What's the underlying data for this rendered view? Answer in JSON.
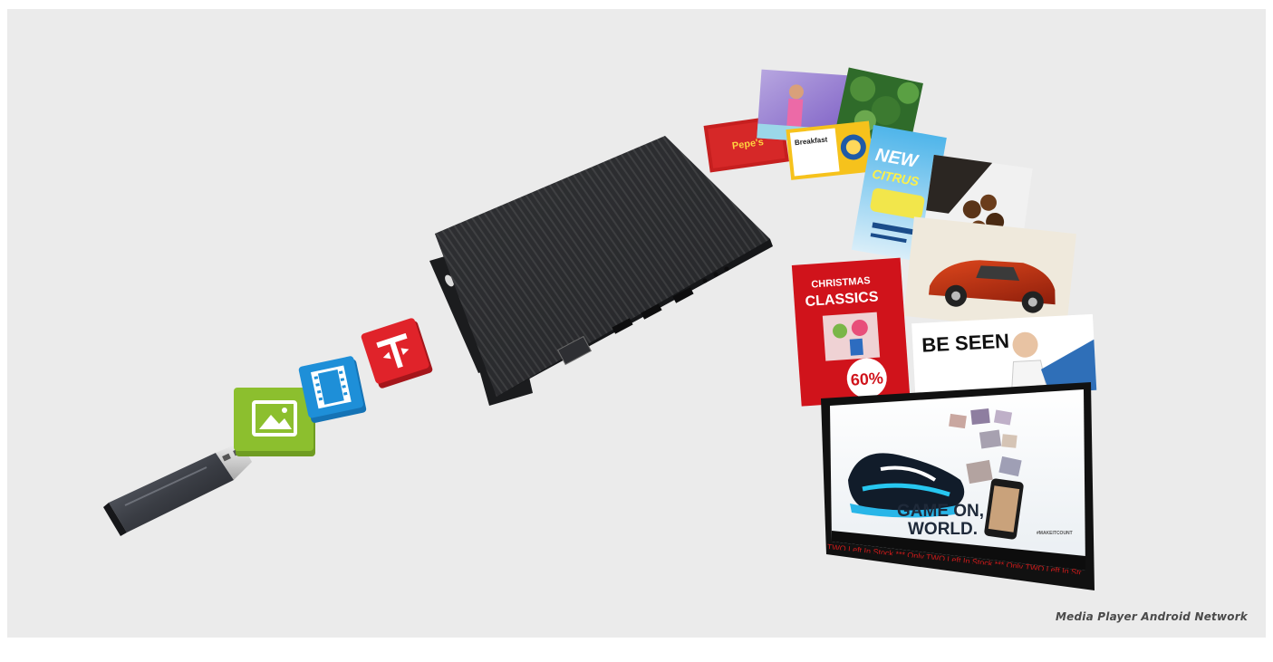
{
  "caption": "Media Player Android Network",
  "media_cards": {
    "pepes": "Pepe's",
    "breakfast": "Breakfast",
    "citrus_new": "NEW",
    "citrus_line": "CITRUS",
    "christmas_line1": "CHRISTMAS",
    "christmas_line2": "CLASSICS",
    "discount": "60%",
    "fashion": "BE SEEN"
  },
  "monitor": {
    "headline_line1": "GAME ON,",
    "headline_line2": "WORLD.",
    "hashtag": "#MAKEITCOUNT",
    "ticker": "TWO Left In Stock *** Only TWO Left In Stock *** Only TWO Left In Stock *** Only TV"
  },
  "colors": {
    "background": "#ebebeb",
    "icon_image": "#8cbf2e",
    "icon_video": "#1e8fd8",
    "icon_text": "#e0232a",
    "ticker_text": "#d11b1b"
  },
  "icons": [
    "usb-drive-icon",
    "image-file-icon",
    "video-file-icon",
    "text-file-icon"
  ]
}
